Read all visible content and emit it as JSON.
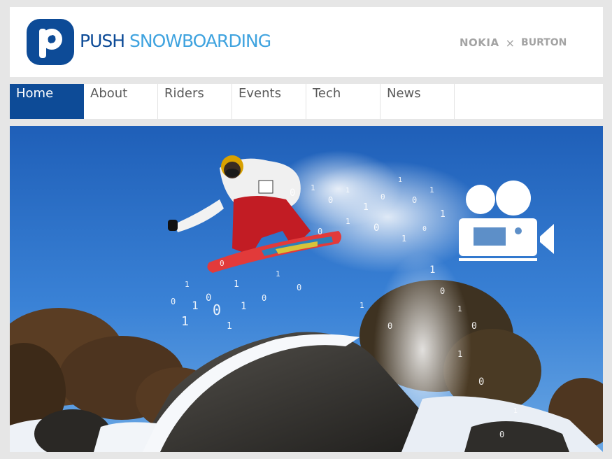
{
  "header": {
    "logo": {
      "word1": "PUSH",
      "word2": "SNOWBOARDING"
    },
    "sponsors": {
      "brand_a": "NOKIA",
      "separator": "×",
      "brand_b": "BURTON"
    },
    "colors": {
      "brand_dark": "#0d4b97",
      "brand_light": "#3fa3df",
      "sponsor_gray": "#a3a3a3"
    }
  },
  "nav": {
    "items": [
      {
        "label": "Home",
        "active": true
      },
      {
        "label": "About",
        "active": false
      },
      {
        "label": "Riders",
        "active": false
      },
      {
        "label": "Events",
        "active": false
      },
      {
        "label": "Tech",
        "active": false
      },
      {
        "label": "News",
        "active": false
      }
    ]
  },
  "hero": {
    "image": "snowboarder-jump-photo",
    "overlay_icon": "video-camera-icon",
    "particle_glyphs": [
      "0",
      "1"
    ]
  }
}
